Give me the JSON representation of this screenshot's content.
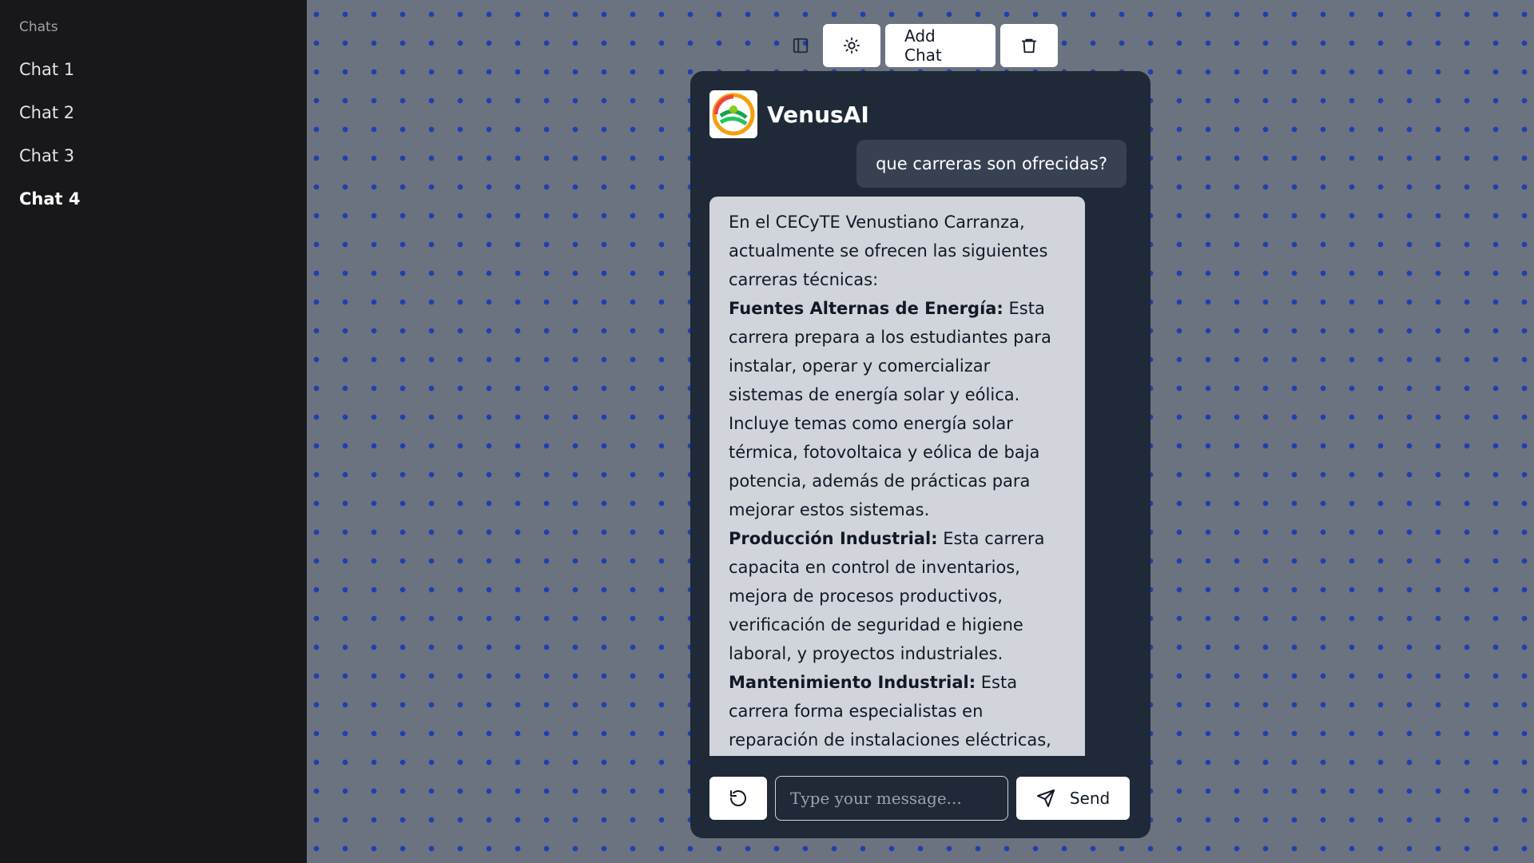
{
  "sidebar": {
    "title": "Chats",
    "items": [
      {
        "label": "Chat 1"
      },
      {
        "label": "Chat 2"
      },
      {
        "label": "Chat 3"
      },
      {
        "label": "Chat 4"
      }
    ],
    "active_index": 3
  },
  "toolbar": {
    "sidebar_toggle_icon": "panel-left-icon",
    "theme_icon": "sun-icon",
    "add_chat_label": "Add Chat",
    "delete_icon": "trash-icon"
  },
  "chat": {
    "brand": "VenusAI",
    "user_message": "que carreras son ofrecidas?",
    "bot_message": {
      "intro": "En el CECyTE Venustiano Carranza, actualmente se ofrecen las siguientes carreras técnicas:",
      "items": [
        {
          "title": "Fuentes Alternas de Energía:",
          "text": " Esta carrera prepara a los estudiantes para instalar, operar y comercializar sistemas de energía solar y eólica. Incluye temas como energía solar térmica, fotovoltaica y eólica de baja potencia, además de prácticas para mejorar estos sistemas."
        },
        {
          "title": "Producción Industrial:",
          "text": " Esta carrera capacita en control de inventarios, mejora de procesos productivos, verificación de seguridad e higiene laboral, y proyectos industriales."
        },
        {
          "title": "Mantenimiento Industrial:",
          "text": " Esta carrera forma especialistas en reparación de instalaciones eléctricas,"
        }
      ]
    }
  },
  "composer": {
    "reset_icon": "rotate-ccw-icon",
    "placeholder": "Type your message...",
    "send_icon": "send-icon",
    "send_label": "Send"
  },
  "colors": {
    "sidebar_bg": "#18181b",
    "canvas_bg": "#6b7280",
    "dot": "#1e40af",
    "chat_bg": "#1f2937",
    "user_bubble": "#374151",
    "bot_bubble": "#d1d5db"
  }
}
